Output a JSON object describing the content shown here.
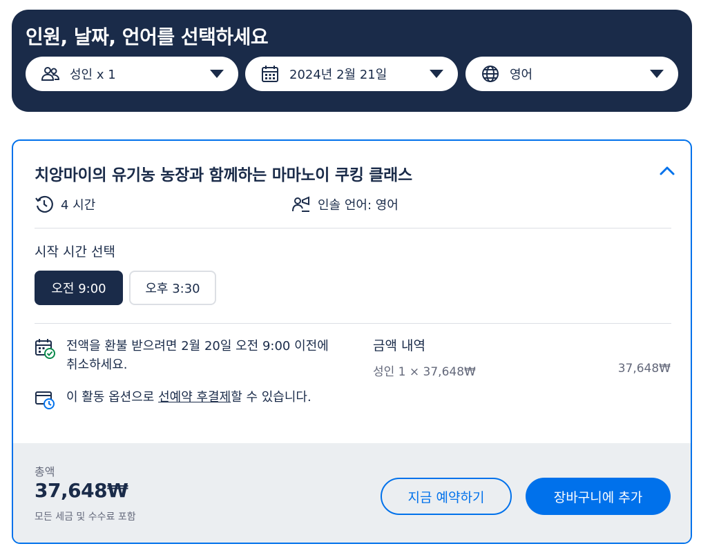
{
  "header": {
    "title": "인원, 날짜, 언어를 선택하세요",
    "selectors": [
      {
        "label": "성인 x 1",
        "icon": "people-icon"
      },
      {
        "label": "2024년 2월 21일",
        "icon": "calendar-icon"
      },
      {
        "label": "영어",
        "icon": "globe-icon"
      }
    ]
  },
  "option": {
    "title": "치앙마이의 유기농 농장과 함께하는 마마노이 쿠킹 클래스",
    "duration": "4 시간",
    "guide_language": "인솔 언어: 영어",
    "start_time_label": "시작 시간 선택",
    "times": [
      {
        "label": "오전 9:00",
        "selected": true
      },
      {
        "label": "오후 3:30",
        "selected": false
      }
    ],
    "cancellation": "전액을 환불 받으려면 2월 20일 오전 9:00 이전에 취소하세요.",
    "reserve_prefix": "이 활동 옵션으로 ",
    "reserve_link": "선예약 후결제",
    "reserve_suffix": "할 수 있습니다.",
    "price_breakdown": {
      "title": "금액 내역",
      "line_label": "성인 1 × 37,648₩",
      "line_amount": "37,648₩"
    }
  },
  "footer": {
    "total_label": "총액",
    "total_value": "37,648₩",
    "total_note": "모든 세금 및 수수료 포함",
    "book_now": "지금 예약하기",
    "add_to_cart": "장바구니에 추가"
  },
  "colors": {
    "navy": "#1a2b49",
    "accent_blue": "#0071eb",
    "gray_text": "#63687a",
    "footer_bg": "#ebeef1",
    "check_green": "#0a8a4b"
  }
}
